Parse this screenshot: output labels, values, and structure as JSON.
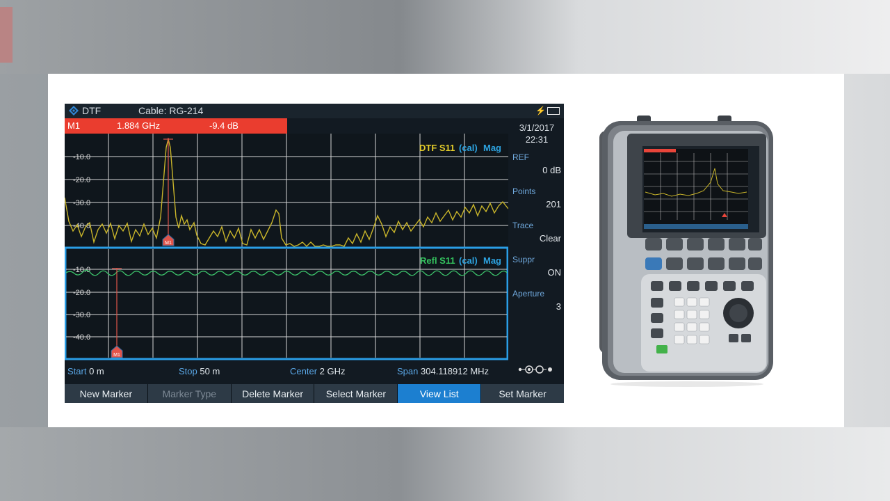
{
  "header": {
    "mode": "DTF",
    "cable": "Cable: RG-214"
  },
  "marker_readout": {
    "name": "M1",
    "frequency": "1.884 GHz",
    "level": "-9.4 dB"
  },
  "datetime": {
    "date": "3/1/2017",
    "time": "22:31"
  },
  "side_panel": [
    {
      "label": "REF",
      "value": "0 dB"
    },
    {
      "label": "Points",
      "value": "201"
    },
    {
      "label": "Trace",
      "value": "Clear"
    },
    {
      "label": "Suppr",
      "value": "ON"
    },
    {
      "label": "Aperture",
      "value": "3"
    }
  ],
  "top_plot": {
    "title_main": "DTF S11",
    "title_cal": "(cal)",
    "title_mag": "Mag",
    "y_ticks": [
      "-10.0",
      "-20.0",
      "-30.0",
      "-40.0"
    ],
    "marker_label": "M1"
  },
  "bottom_plot": {
    "title_main": "Refl S11",
    "title_cal": "(cal)",
    "title_mag": "Mag",
    "y_ticks": [
      "-10.0",
      "-20.0",
      "-30.0",
      "-40.0"
    ],
    "marker_label": "M1"
  },
  "frequency_bar": {
    "start_label": "Start",
    "start_value": "0 m",
    "stop_label": "Stop",
    "stop_value": "50 m",
    "center_label": "Center",
    "center_value": "2 GHz",
    "span_label": "Span",
    "span_value": "304.118912 MHz"
  },
  "softkeys": [
    "New Marker",
    "Marker Type",
    "Delete Marker",
    "Select Marker",
    "View List",
    "Set Marker"
  ],
  "colors": {
    "marker_bar": "#ea3d2f",
    "dtf_trace": "#c9b52a",
    "refl_trace": "#3cc26a",
    "active_softkey": "#1c7fd0",
    "plot_border": "#2a9ee6"
  }
}
